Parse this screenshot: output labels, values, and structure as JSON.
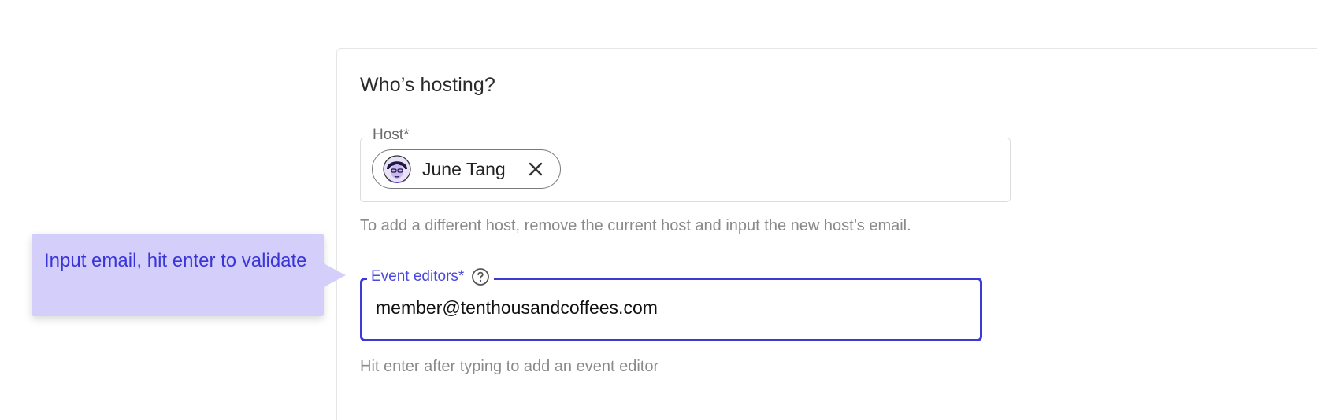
{
  "section": {
    "title": "Who’s hosting?"
  },
  "host": {
    "label": "Host*",
    "chip_name": "June Tang",
    "helper": "To add a different host, remove the current host and input the new host’s email."
  },
  "editors": {
    "label": "Event editors*",
    "value": "member@tenthousandcoffees.com",
    "helper": "Hit enter after typing to add an event editor"
  },
  "tooltip": {
    "text": "Input email, hit enter to validate"
  },
  "colors": {
    "accent": "#3b3ad6",
    "tooltip_bg": "#d4cffa",
    "tooltip_text": "#3b35d8"
  },
  "icons": {
    "chip_remove": "close-icon",
    "editors_help": "help-circle-icon",
    "host_avatar": "avatar"
  }
}
